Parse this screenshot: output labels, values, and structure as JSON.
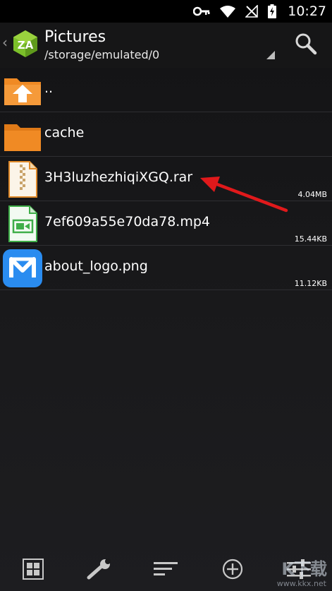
{
  "status_bar": {
    "time": "10:27",
    "icons": [
      "key-icon",
      "wifi-icon",
      "no-signal-icon",
      "battery-charging-icon"
    ]
  },
  "app_bar": {
    "title": "Pictures",
    "path": "/storage/emulated/0",
    "icons": [
      "back-chevron-icon",
      "zarchiver-logo-icon",
      "dropdown-triangle-icon",
      "search-icon"
    ]
  },
  "files": [
    {
      "name": "..",
      "size": "",
      "icon": "folder-up-icon"
    },
    {
      "name": "cache",
      "size": "",
      "icon": "folder-icon"
    },
    {
      "name": "3H3luzhezhiqiXGQ.rar",
      "size": "4.04MB",
      "icon": "archive-file-icon"
    },
    {
      "name": "7ef609a55e70da78.mp4",
      "size": "15.44KB",
      "icon": "video-file-icon"
    },
    {
      "name": "about_logo.png",
      "size": "11.12KB",
      "icon": "app-logo-image-icon"
    }
  ],
  "toolbar": {
    "buttons": [
      "grid-view-icon",
      "wrench-icon",
      "sort-icon",
      "add-circle-icon",
      "sliders-icon"
    ]
  },
  "watermark": {
    "text": "www.kkx.net"
  },
  "colors": {
    "background": "#1a1a1c",
    "folder": "#f08a24",
    "annotation_arrow": "#e0191b",
    "divider": "#2e2e32"
  }
}
